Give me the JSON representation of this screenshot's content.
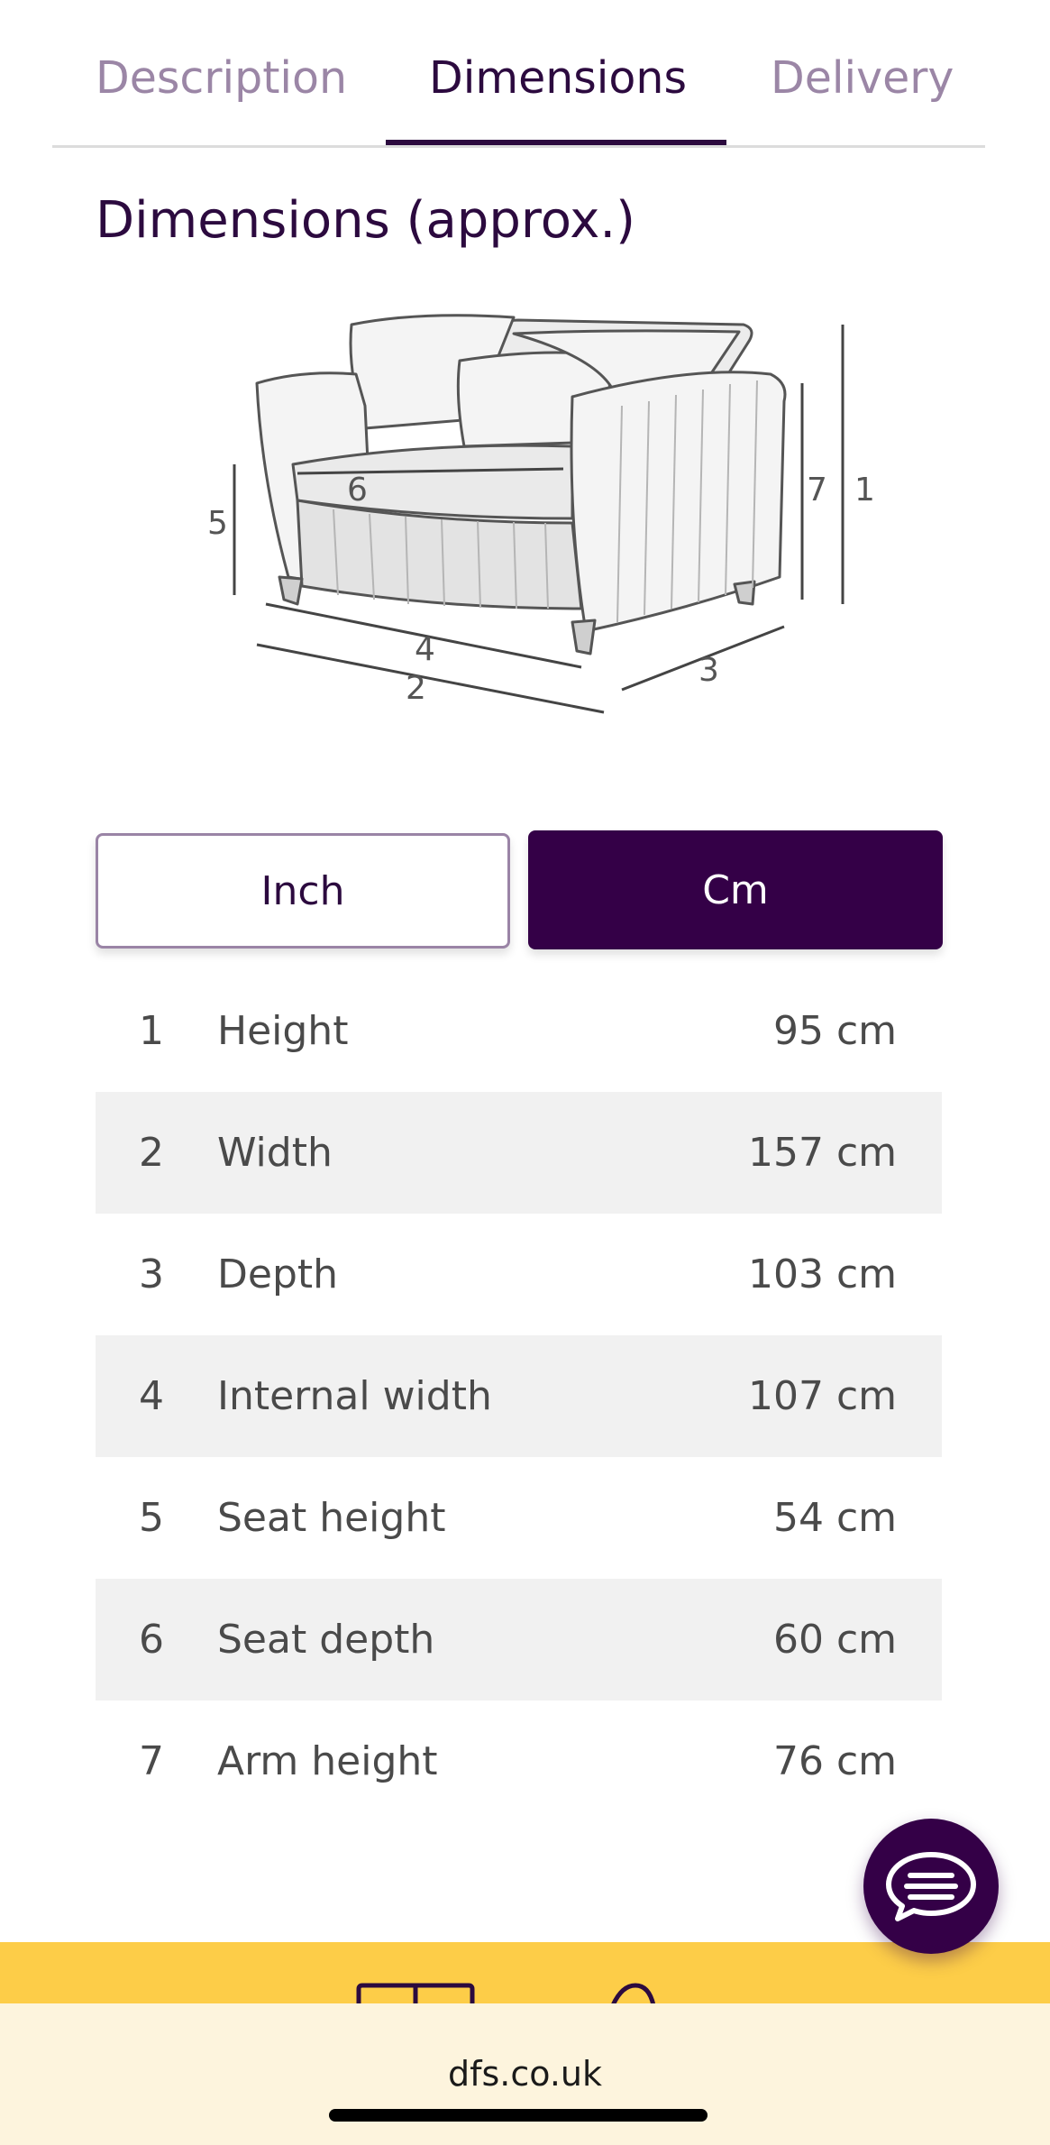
{
  "tabs": [
    {
      "label": "Description"
    },
    {
      "label": "Dimensions"
    },
    {
      "label": "Delivery"
    }
  ],
  "heading": "Dimensions (approx.)",
  "diagram_labels": [
    "1",
    "2",
    "3",
    "4",
    "5",
    "6",
    "7"
  ],
  "units": {
    "inch_label": "Inch",
    "cm_label": "Cm",
    "selected": "Cm"
  },
  "dimensions": [
    {
      "num": "1",
      "label": "Height",
      "value": "95 cm"
    },
    {
      "num": "2",
      "label": "Width",
      "value": "157 cm"
    },
    {
      "num": "3",
      "label": "Depth",
      "value": "103 cm"
    },
    {
      "num": "4",
      "label": "Internal width",
      "value": "107 cm"
    },
    {
      "num": "5",
      "label": "Seat height",
      "value": "54 cm"
    },
    {
      "num": "6",
      "label": "Seat depth",
      "value": "60 cm"
    },
    {
      "num": "7",
      "label": "Arm height",
      "value": "76 cm"
    }
  ],
  "browser": {
    "url": "dfs.co.uk"
  },
  "colors": {
    "brand_purple": "#340047",
    "accent_yellow": "#fdcd48"
  }
}
